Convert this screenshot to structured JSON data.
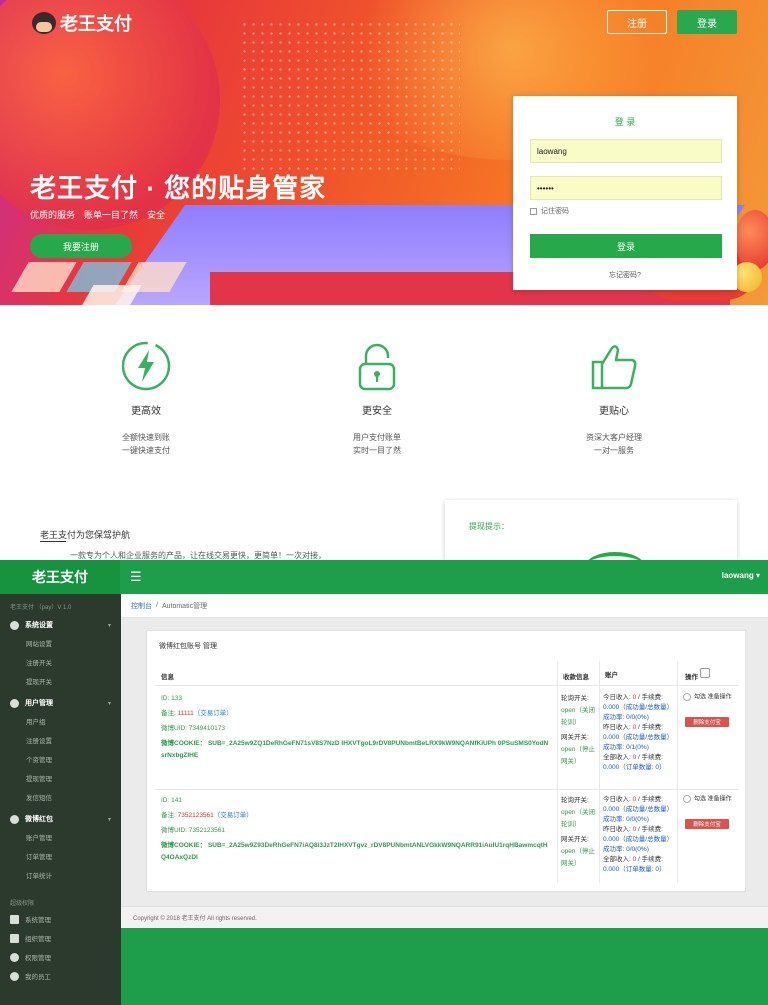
{
  "landing": {
    "brand": "老王支付",
    "nav": {
      "register": "注册",
      "login": "登录"
    },
    "hero_title": "老王支付 · 您的贴身管家",
    "hero_sub": "优质的服务　账单一目了然　安全",
    "hero_cta": "我要注册",
    "login_form": {
      "title": "登 录",
      "username": "laowang",
      "password": "••••••",
      "remember": "记住密码",
      "submit": "登录",
      "forgot": "忘记密码?"
    },
    "features": [
      {
        "icon": "lightning-icon",
        "title": "更高效",
        "line1": "全额快速到账",
        "line2": "一键快速支付"
      },
      {
        "icon": "lock-icon",
        "title": "更安全",
        "line1": "用户支付账单",
        "line2": "实时一目了然"
      },
      {
        "icon": "thumbs-up-icon",
        "title": "更贴心",
        "line1": "资深大客户经理",
        "line2": "一对一服务"
      }
    ],
    "guard_title": "老王支付为您保驾护航",
    "guard_desc": "一款专为个人和企业服务的产品，让在线交易更快，更简单！一次对接，",
    "side_card_title": "提现提示："
  },
  "admin": {
    "brand": "老王支付",
    "user": "laowang",
    "version": "老王支付 （pay）V 1.0",
    "sidebar": {
      "groups": [
        {
          "label": "系统设置",
          "icon": "gear-icon",
          "items": [
            "网站设置",
            "注册开关",
            "提现开关"
          ]
        },
        {
          "label": "用户管理",
          "icon": "user-icon",
          "items": [
            "用户组",
            "注册设置",
            "个资管理",
            "提现管理",
            "发信短信"
          ]
        },
        {
          "label": "微博红包",
          "icon": "weibo-icon",
          "items": [
            "账户管理",
            "订单管理",
            "订单统计"
          ]
        }
      ],
      "section_label": "超级权限",
      "bottom_items": [
        {
          "label": "系统管理",
          "icon": "cube-icon"
        },
        {
          "label": "组织管理",
          "icon": "sitemap-icon"
        },
        {
          "label": "权限管理",
          "icon": "users-icon"
        },
        {
          "label": "我的员工",
          "icon": "staff-icon"
        }
      ]
    },
    "breadcrumb": {
      "home": "控制台",
      "sep": "/",
      "current": "Automatic管理"
    },
    "panel_title": "微博红包账号 管理",
    "columns": {
      "info": "信息",
      "switch": "收款信息",
      "account": "账户",
      "op": "操作"
    },
    "rows": [
      {
        "id": "ID: 133",
        "note_label": "备注: ",
        "note_value": "11111",
        "note_link": "（交易订单）",
        "uid": "微博UID: 7349410173",
        "cookie": "微博COOKIE： SUB=_2A25w9ZQ1DeRhGeFN71sV8S7NzD IHXVTgoL9rDV8PUNbmtBeLRX9kW9NQANfKiUPh 0PSuSMS0YodNsrNxbgZIHE",
        "switch": [
          {
            "label": "轮询开关: ",
            "value": "open（关闭轮训）"
          },
          {
            "label": "网关开关: ",
            "value": "open（停止网关）"
          }
        ],
        "account": [
          {
            "label": "今日收入: ",
            "amount": "0",
            "suffix": " / 手续费:",
            "rate": "0.000（成功量/总数量）",
            "ratio": "成功率: 0/0(0%)"
          },
          {
            "label": "昨日收入: ",
            "amount": "0",
            "suffix": " / 手续费:",
            "rate": "0.000（成功量/总数量）",
            "ratio": "成功率: 0/1(0%)"
          },
          {
            "label": "全部收入: ",
            "amount": "0",
            "suffix": " / 手续费:",
            "rate": "0.000（订单数量: 0）",
            "ratio": ""
          }
        ],
        "op_check": "勾选 准备操作",
        "op_button": "删除支付宝"
      },
      {
        "id": "ID: 141",
        "note_label": "备注: ",
        "note_value": "7352123561",
        "note_link": "（交易订单）",
        "uid": "微博UID: 7352123561",
        "cookie": "微博COOKIE： SUB=_2A25w9Z93DeRhGeFN7iAQ8i3JzT2IHXVTgvz_rDV8PUNbmtANLVGkkW9NQARR91iAuIU1rqHBawmcqtHQ4OAxQzDI",
        "switch": [
          {
            "label": "轮询开关: ",
            "value": "open（关闭轮训）"
          },
          {
            "label": "网关开关: ",
            "value": "open（停止网关）"
          }
        ],
        "account": [
          {
            "label": "今日收入: ",
            "amount": "0",
            "suffix": " / 手续费:",
            "rate": "0.000（成功量/总数量）",
            "ratio": "成功率: 0/0(0%)"
          },
          {
            "label": "昨日收入: ",
            "amount": "0",
            "suffix": " / 手续费:",
            "rate": "0.000（成功量/总数量）",
            "ratio": "成功率: 0/0(0%)"
          },
          {
            "label": "全部收入: ",
            "amount": "0",
            "suffix": " / 手续费:",
            "rate": "0.000（订单数量: 0）",
            "ratio": ""
          }
        ],
        "op_check": "勾选 准备操作",
        "op_button": "删除支付宝"
      }
    ],
    "footer": "Copyright © 2018 老王支付 All rights reserved."
  }
}
